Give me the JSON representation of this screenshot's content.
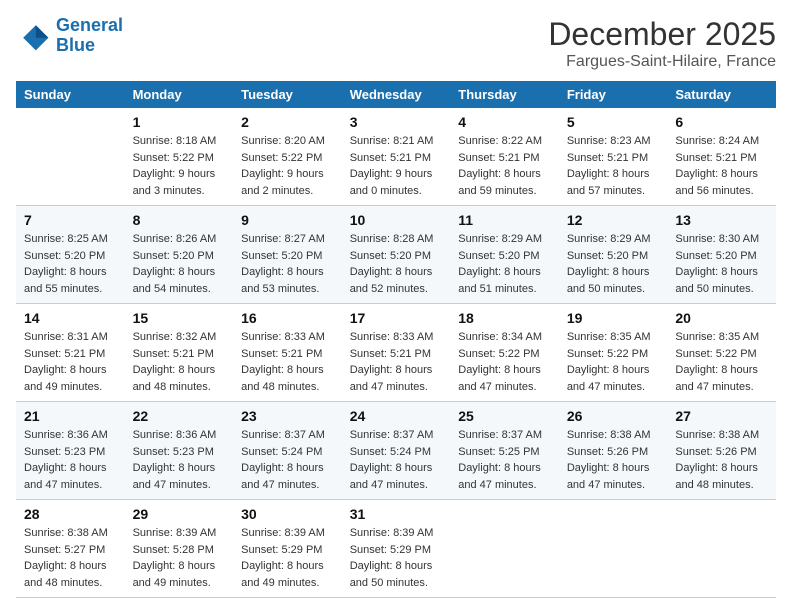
{
  "header": {
    "logo_line1": "General",
    "logo_line2": "Blue",
    "month": "December 2025",
    "location": "Fargues-Saint-Hilaire, France"
  },
  "weekdays": [
    "Sunday",
    "Monday",
    "Tuesday",
    "Wednesday",
    "Thursday",
    "Friday",
    "Saturday"
  ],
  "weeks": [
    [
      {
        "day": "",
        "sunrise": "",
        "sunset": "",
        "daylight": ""
      },
      {
        "day": "1",
        "sunrise": "Sunrise: 8:18 AM",
        "sunset": "Sunset: 5:22 PM",
        "daylight": "Daylight: 9 hours and 3 minutes."
      },
      {
        "day": "2",
        "sunrise": "Sunrise: 8:20 AM",
        "sunset": "Sunset: 5:22 PM",
        "daylight": "Daylight: 9 hours and 2 minutes."
      },
      {
        "day": "3",
        "sunrise": "Sunrise: 8:21 AM",
        "sunset": "Sunset: 5:21 PM",
        "daylight": "Daylight: 9 hours and 0 minutes."
      },
      {
        "day": "4",
        "sunrise": "Sunrise: 8:22 AM",
        "sunset": "Sunset: 5:21 PM",
        "daylight": "Daylight: 8 hours and 59 minutes."
      },
      {
        "day": "5",
        "sunrise": "Sunrise: 8:23 AM",
        "sunset": "Sunset: 5:21 PM",
        "daylight": "Daylight: 8 hours and 57 minutes."
      },
      {
        "day": "6",
        "sunrise": "Sunrise: 8:24 AM",
        "sunset": "Sunset: 5:21 PM",
        "daylight": "Daylight: 8 hours and 56 minutes."
      }
    ],
    [
      {
        "day": "7",
        "sunrise": "Sunrise: 8:25 AM",
        "sunset": "Sunset: 5:20 PM",
        "daylight": "Daylight: 8 hours and 55 minutes."
      },
      {
        "day": "8",
        "sunrise": "Sunrise: 8:26 AM",
        "sunset": "Sunset: 5:20 PM",
        "daylight": "Daylight: 8 hours and 54 minutes."
      },
      {
        "day": "9",
        "sunrise": "Sunrise: 8:27 AM",
        "sunset": "Sunset: 5:20 PM",
        "daylight": "Daylight: 8 hours and 53 minutes."
      },
      {
        "day": "10",
        "sunrise": "Sunrise: 8:28 AM",
        "sunset": "Sunset: 5:20 PM",
        "daylight": "Daylight: 8 hours and 52 minutes."
      },
      {
        "day": "11",
        "sunrise": "Sunrise: 8:29 AM",
        "sunset": "Sunset: 5:20 PM",
        "daylight": "Daylight: 8 hours and 51 minutes."
      },
      {
        "day": "12",
        "sunrise": "Sunrise: 8:29 AM",
        "sunset": "Sunset: 5:20 PM",
        "daylight": "Daylight: 8 hours and 50 minutes."
      },
      {
        "day": "13",
        "sunrise": "Sunrise: 8:30 AM",
        "sunset": "Sunset: 5:20 PM",
        "daylight": "Daylight: 8 hours and 50 minutes."
      }
    ],
    [
      {
        "day": "14",
        "sunrise": "Sunrise: 8:31 AM",
        "sunset": "Sunset: 5:21 PM",
        "daylight": "Daylight: 8 hours and 49 minutes."
      },
      {
        "day": "15",
        "sunrise": "Sunrise: 8:32 AM",
        "sunset": "Sunset: 5:21 PM",
        "daylight": "Daylight: 8 hours and 48 minutes."
      },
      {
        "day": "16",
        "sunrise": "Sunrise: 8:33 AM",
        "sunset": "Sunset: 5:21 PM",
        "daylight": "Daylight: 8 hours and 48 minutes."
      },
      {
        "day": "17",
        "sunrise": "Sunrise: 8:33 AM",
        "sunset": "Sunset: 5:21 PM",
        "daylight": "Daylight: 8 hours and 47 minutes."
      },
      {
        "day": "18",
        "sunrise": "Sunrise: 8:34 AM",
        "sunset": "Sunset: 5:22 PM",
        "daylight": "Daylight: 8 hours and 47 minutes."
      },
      {
        "day": "19",
        "sunrise": "Sunrise: 8:35 AM",
        "sunset": "Sunset: 5:22 PM",
        "daylight": "Daylight: 8 hours and 47 minutes."
      },
      {
        "day": "20",
        "sunrise": "Sunrise: 8:35 AM",
        "sunset": "Sunset: 5:22 PM",
        "daylight": "Daylight: 8 hours and 47 minutes."
      }
    ],
    [
      {
        "day": "21",
        "sunrise": "Sunrise: 8:36 AM",
        "sunset": "Sunset: 5:23 PM",
        "daylight": "Daylight: 8 hours and 47 minutes."
      },
      {
        "day": "22",
        "sunrise": "Sunrise: 8:36 AM",
        "sunset": "Sunset: 5:23 PM",
        "daylight": "Daylight: 8 hours and 47 minutes."
      },
      {
        "day": "23",
        "sunrise": "Sunrise: 8:37 AM",
        "sunset": "Sunset: 5:24 PM",
        "daylight": "Daylight: 8 hours and 47 minutes."
      },
      {
        "day": "24",
        "sunrise": "Sunrise: 8:37 AM",
        "sunset": "Sunset: 5:24 PM",
        "daylight": "Daylight: 8 hours and 47 minutes."
      },
      {
        "day": "25",
        "sunrise": "Sunrise: 8:37 AM",
        "sunset": "Sunset: 5:25 PM",
        "daylight": "Daylight: 8 hours and 47 minutes."
      },
      {
        "day": "26",
        "sunrise": "Sunrise: 8:38 AM",
        "sunset": "Sunset: 5:26 PM",
        "daylight": "Daylight: 8 hours and 47 minutes."
      },
      {
        "day": "27",
        "sunrise": "Sunrise: 8:38 AM",
        "sunset": "Sunset: 5:26 PM",
        "daylight": "Daylight: 8 hours and 48 minutes."
      }
    ],
    [
      {
        "day": "28",
        "sunrise": "Sunrise: 8:38 AM",
        "sunset": "Sunset: 5:27 PM",
        "daylight": "Daylight: 8 hours and 48 minutes."
      },
      {
        "day": "29",
        "sunrise": "Sunrise: 8:39 AM",
        "sunset": "Sunset: 5:28 PM",
        "daylight": "Daylight: 8 hours and 49 minutes."
      },
      {
        "day": "30",
        "sunrise": "Sunrise: 8:39 AM",
        "sunset": "Sunset: 5:29 PM",
        "daylight": "Daylight: 8 hours and 49 minutes."
      },
      {
        "day": "31",
        "sunrise": "Sunrise: 8:39 AM",
        "sunset": "Sunset: 5:29 PM",
        "daylight": "Daylight: 8 hours and 50 minutes."
      },
      {
        "day": "",
        "sunrise": "",
        "sunset": "",
        "daylight": ""
      },
      {
        "day": "",
        "sunrise": "",
        "sunset": "",
        "daylight": ""
      },
      {
        "day": "",
        "sunrise": "",
        "sunset": "",
        "daylight": ""
      }
    ]
  ]
}
